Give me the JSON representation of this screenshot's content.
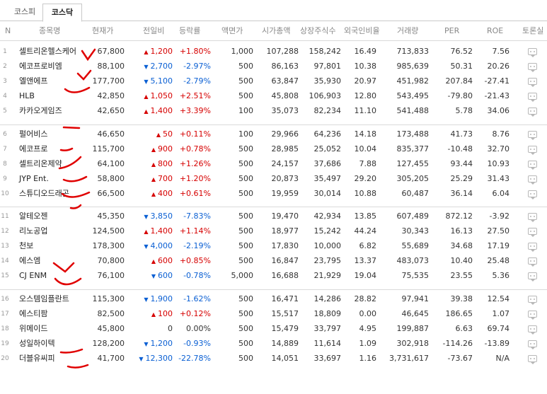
{
  "tabs": [
    {
      "label": "코스피",
      "active": false
    },
    {
      "label": "코스닥",
      "active": true
    }
  ],
  "columns": {
    "n": "N",
    "name": "종목명",
    "price": "현재가",
    "change": "전일비",
    "rate": "등락률",
    "par": "액면가",
    "cap": "시가총액",
    "shares": "상장주식수",
    "foreign": "외국인비율",
    "volume": "거래량",
    "per": "PER",
    "roe": "ROE",
    "talk": "토론실"
  },
  "rows": [
    {
      "n": "1",
      "name": "셀트리온헬스케어",
      "price": "67,800",
      "dir": "up",
      "chg": "1,200",
      "rate": "+1.80%",
      "par": "1,000",
      "cap": "107,288",
      "shares": "158,242",
      "for": "16.49",
      "vol": "713,833",
      "per": "76.52",
      "roe": "7.56"
    },
    {
      "n": "2",
      "name": "에코프로비엠",
      "price": "88,100",
      "dir": "down",
      "chg": "2,700",
      "rate": "-2.97%",
      "par": "500",
      "cap": "86,163",
      "shares": "97,801",
      "for": "10.38",
      "vol": "985,639",
      "per": "50.31",
      "roe": "20.26"
    },
    {
      "n": "3",
      "name": "엘앤에프",
      "price": "177,700",
      "dir": "down",
      "chg": "5,100",
      "rate": "-2.79%",
      "par": "500",
      "cap": "63,847",
      "shares": "35,930",
      "for": "20.97",
      "vol": "451,982",
      "per": "207.84",
      "roe": "-27.41"
    },
    {
      "n": "4",
      "name": "HLB",
      "price": "42,850",
      "dir": "up",
      "chg": "1,050",
      "rate": "+2.51%",
      "par": "500",
      "cap": "45,808",
      "shares": "106,903",
      "for": "12.80",
      "vol": "543,495",
      "per": "-79.80",
      "roe": "-21.43"
    },
    {
      "n": "5",
      "name": "카카오게임즈",
      "price": "42,650",
      "dir": "up",
      "chg": "1,400",
      "rate": "+3.39%",
      "par": "100",
      "cap": "35,073",
      "shares": "82,234",
      "for": "11.10",
      "vol": "541,488",
      "per": "5.78",
      "roe": "34.06"
    },
    {
      "n": "6",
      "name": "펄어비스",
      "price": "46,650",
      "dir": "up",
      "chg": "50",
      "rate": "+0.11%",
      "par": "100",
      "cap": "29,966",
      "shares": "64,236",
      "for": "14.18",
      "vol": "173,488",
      "per": "41.73",
      "roe": "8.76"
    },
    {
      "n": "7",
      "name": "에코프로",
      "price": "115,700",
      "dir": "up",
      "chg": "900",
      "rate": "+0.78%",
      "par": "500",
      "cap": "28,985",
      "shares": "25,052",
      "for": "10.04",
      "vol": "835,377",
      "per": "-10.48",
      "roe": "32.70"
    },
    {
      "n": "8",
      "name": "셀트리온제약",
      "price": "64,100",
      "dir": "up",
      "chg": "800",
      "rate": "+1.26%",
      "par": "500",
      "cap": "24,157",
      "shares": "37,686",
      "for": "7.88",
      "vol": "127,455",
      "per": "93.44",
      "roe": "10.93"
    },
    {
      "n": "9",
      "name": "JYP Ent.",
      "price": "58,800",
      "dir": "up",
      "chg": "700",
      "rate": "+1.20%",
      "par": "500",
      "cap": "20,873",
      "shares": "35,497",
      "for": "29.20",
      "vol": "305,205",
      "per": "25.29",
      "roe": "31.43"
    },
    {
      "n": "10",
      "name": "스튜디오드래곤",
      "price": "66,500",
      "dir": "up",
      "chg": "400",
      "rate": "+0.61%",
      "par": "500",
      "cap": "19,959",
      "shares": "30,014",
      "for": "10.88",
      "vol": "60,487",
      "per": "36.14",
      "roe": "6.04"
    },
    {
      "n": "11",
      "name": "알테오젠",
      "price": "45,350",
      "dir": "down",
      "chg": "3,850",
      "rate": "-7.83%",
      "par": "500",
      "cap": "19,470",
      "shares": "42,934",
      "for": "13.85",
      "vol": "607,489",
      "per": "872.12",
      "roe": "-3.92"
    },
    {
      "n": "12",
      "name": "리노공업",
      "price": "124,500",
      "dir": "up",
      "chg": "1,400",
      "rate": "+1.14%",
      "par": "500",
      "cap": "18,977",
      "shares": "15,242",
      "for": "44.24",
      "vol": "30,343",
      "per": "16.13",
      "roe": "27.50"
    },
    {
      "n": "13",
      "name": "천보",
      "price": "178,300",
      "dir": "down",
      "chg": "4,000",
      "rate": "-2.19%",
      "par": "500",
      "cap": "17,830",
      "shares": "10,000",
      "for": "6.82",
      "vol": "55,689",
      "per": "34.68",
      "roe": "17.19"
    },
    {
      "n": "14",
      "name": "에스엠",
      "price": "70,800",
      "dir": "up",
      "chg": "600",
      "rate": "+0.85%",
      "par": "500",
      "cap": "16,847",
      "shares": "23,795",
      "for": "13.37",
      "vol": "483,073",
      "per": "10.40",
      "roe": "25.48"
    },
    {
      "n": "15",
      "name": "CJ ENM",
      "price": "76,100",
      "dir": "down",
      "chg": "600",
      "rate": "-0.78%",
      "par": "5,000",
      "cap": "16,688",
      "shares": "21,929",
      "for": "19.04",
      "vol": "75,535",
      "per": "23.55",
      "roe": "5.36"
    },
    {
      "n": "16",
      "name": "오스템임플란트",
      "price": "115,300",
      "dir": "down",
      "chg": "1,900",
      "rate": "-1.62%",
      "par": "500",
      "cap": "16,471",
      "shares": "14,286",
      "for": "28.82",
      "vol": "97,941",
      "per": "39.38",
      "roe": "12.54"
    },
    {
      "n": "17",
      "name": "에스티팜",
      "price": "82,500",
      "dir": "up",
      "chg": "100",
      "rate": "+0.12%",
      "par": "500",
      "cap": "15,517",
      "shares": "18,809",
      "for": "0.00",
      "vol": "46,645",
      "per": "186.65",
      "roe": "1.07"
    },
    {
      "n": "18",
      "name": "위메이드",
      "price": "45,800",
      "dir": "flat",
      "chg": "0",
      "rate": "0.00%",
      "par": "500",
      "cap": "15,479",
      "shares": "33,797",
      "for": "4.95",
      "vol": "199,887",
      "per": "6.63",
      "roe": "69.74"
    },
    {
      "n": "19",
      "name": "성일하이텍",
      "price": "128,200",
      "dir": "down",
      "chg": "1,200",
      "rate": "-0.93%",
      "par": "500",
      "cap": "14,889",
      "shares": "11,614",
      "for": "1.09",
      "vol": "302,918",
      "per": "-114.26",
      "roe": "-13.89"
    },
    {
      "n": "20",
      "name": "더블유씨피",
      "price": "41,700",
      "dir": "down",
      "chg": "12,300",
      "rate": "-22.78%",
      "par": "500",
      "cap": "14,051",
      "shares": "33,697",
      "for": "1.16",
      "vol": "3,731,617",
      "per": "-73.67",
      "roe": "N/A"
    }
  ],
  "icons": {
    "arrow_up": "▲",
    "arrow_down": "▼",
    "talk": "comment-icon"
  },
  "colors": {
    "up": "#d60000",
    "down": "#0a5fd3",
    "annotation": "#e00000"
  }
}
